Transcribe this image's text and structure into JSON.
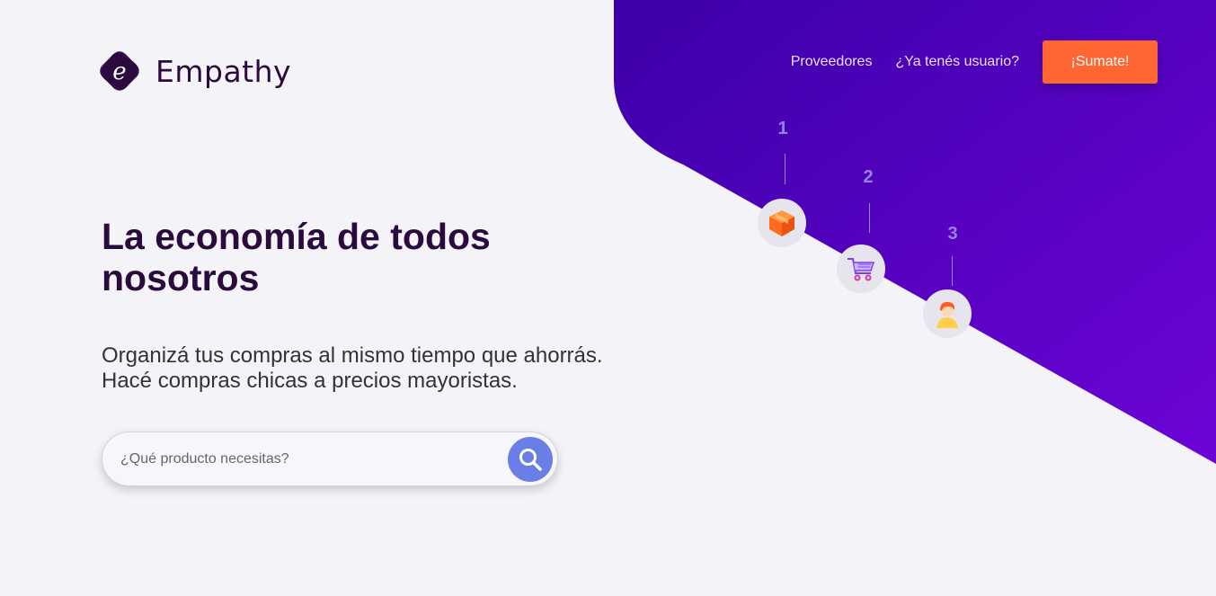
{
  "brand": {
    "name": "Empathy",
    "logo_letter": "e"
  },
  "nav": {
    "providers": "Proveedores",
    "login": "¿Ya tenés usuario?",
    "signup": "¡Sumate!"
  },
  "hero": {
    "title": "La economía de todos nosotros",
    "subtitle_line1": "Organizá tus compras al mismo tiempo que ahorrás.",
    "subtitle_line2": "Hacé compras chicas a precios mayoristas."
  },
  "search": {
    "placeholder": "¿Qué producto necesitas?"
  },
  "steps": [
    {
      "number": "1",
      "icon": "box-icon"
    },
    {
      "number": "2",
      "icon": "shopping-cart-icon"
    },
    {
      "number": "3",
      "icon": "person-icon"
    }
  ],
  "colors": {
    "accent": "#ff6631",
    "brand_purple": "#4a00b8",
    "heading": "#2b0a3d",
    "search_button": "#6a7fe6"
  }
}
